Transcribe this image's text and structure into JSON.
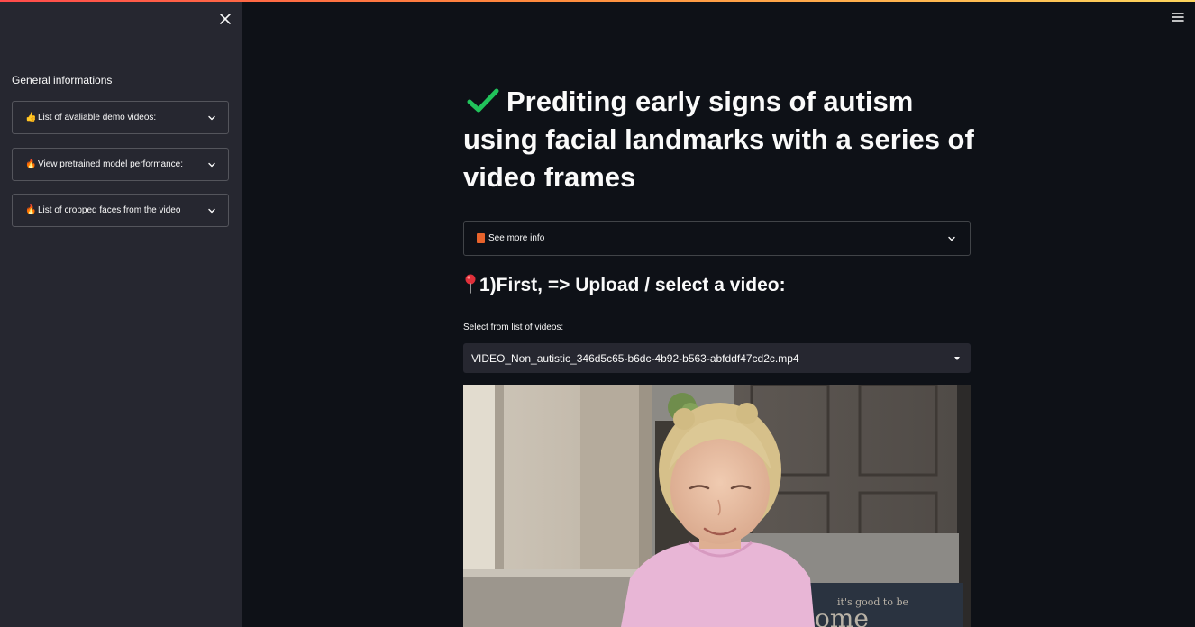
{
  "sidebar": {
    "title": "General informations",
    "expanders": [
      {
        "emoji": "👍",
        "label": "List of avaliable demo videos:"
      },
      {
        "emoji": "🔥",
        "label": "View pretrained model performance:"
      },
      {
        "emoji": "🔥",
        "label": "List of cropped faces from the video"
      }
    ]
  },
  "main": {
    "title": "Prediting early signs of autism using facial landmarks with a series of video frames",
    "info_expander": {
      "label": "See more info"
    },
    "step1": {
      "heading": "1)First, => Upload / select a video:"
    },
    "select": {
      "label": "Select from list of videos:",
      "value": "VIDEO_Non_autistic_346d5c65-b6dc-4b92-b563-abfddf47cd2c.mp4"
    },
    "video": {
      "doormat_text": "it's good to be"
    }
  },
  "colors": {
    "background": "#0e1117",
    "sidebar": "#262730",
    "accent_gradient_start": "#ff4b4b",
    "accent_gradient_end": "#fdd55d",
    "check_green": "#21c35b"
  }
}
